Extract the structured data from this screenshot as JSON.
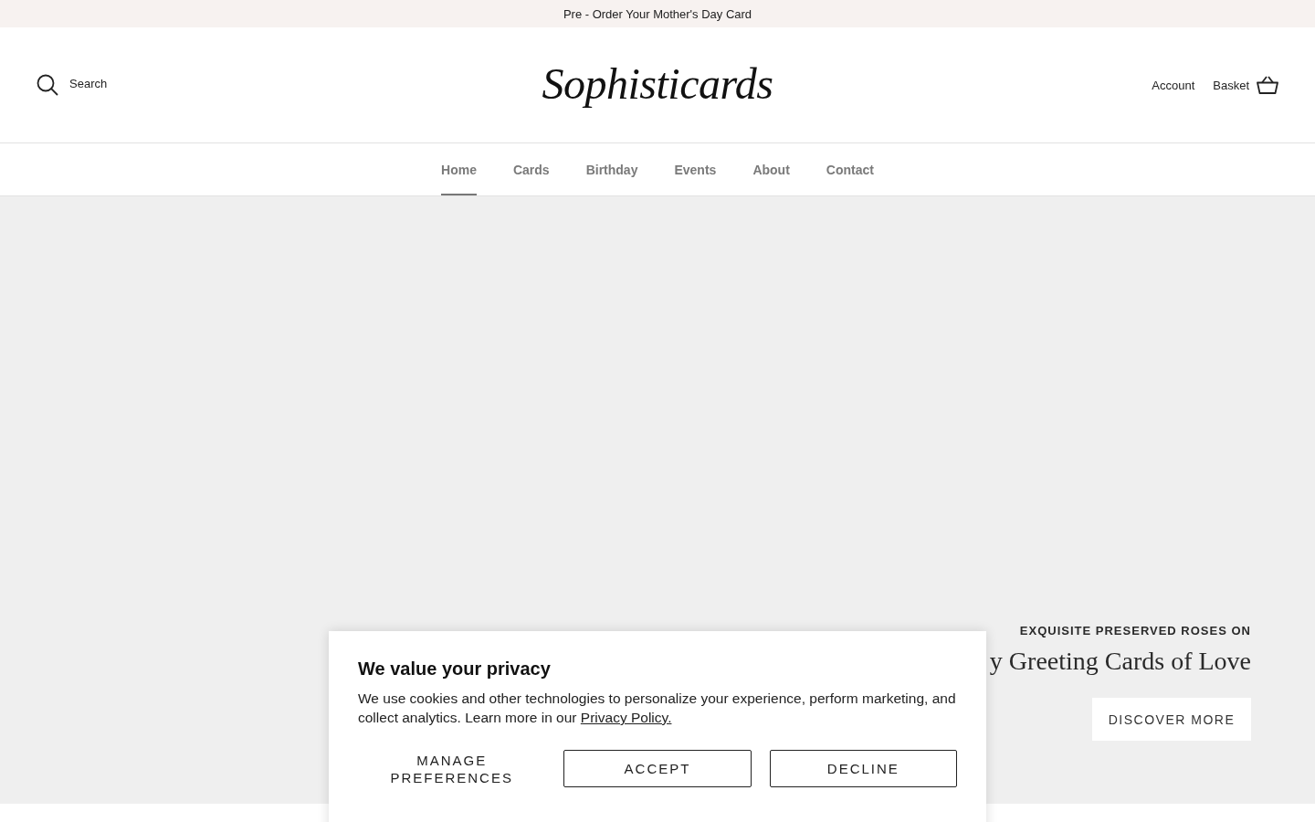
{
  "announcement_bar": {
    "text": "Pre - Order Your Mother's Day Card"
  },
  "header": {
    "search_label": "Search",
    "logo": "Sophisticards",
    "account": "Account",
    "basket": "Basket"
  },
  "nav": [
    {
      "label": "Home",
      "selected": true
    },
    {
      "label": "Cards",
      "selected": false
    },
    {
      "label": "Birthday",
      "selected": false
    },
    {
      "label": "Events",
      "selected": false
    },
    {
      "label": "About",
      "selected": false
    },
    {
      "label": "Contact",
      "selected": false
    }
  ],
  "hero": {
    "eyebrow": "EXQUISITE PRESERVED ROSES ON",
    "heading": "y Greeting Cards of Love",
    "button": "DISCOVER MORE"
  },
  "cookie_banner": {
    "title": "We value your privacy",
    "text": "We use cookies and other technologies to personalize your experience, perform marketing, and collect analytics. Learn more in our ",
    "link": "Privacy Policy.",
    "buttons": [
      {
        "label": "MANAGE PREFERENCES",
        "kind": "text"
      },
      {
        "label": "ACCEPT",
        "kind": "outline"
      },
      {
        "label": "DECLINE",
        "kind": "outline"
      }
    ]
  }
}
